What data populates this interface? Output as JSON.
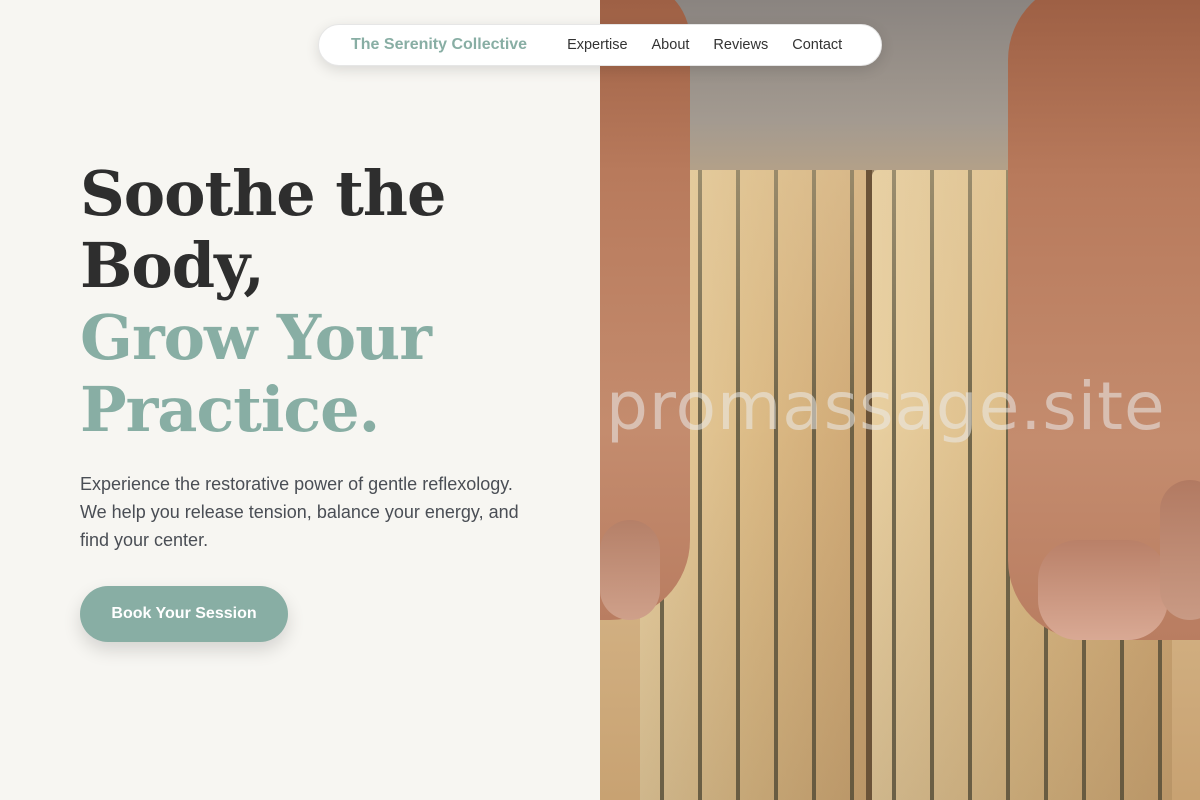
{
  "nav": {
    "brand": "The Serenity Collective",
    "links": [
      "Expertise",
      "About",
      "Reviews",
      "Contact"
    ]
  },
  "hero": {
    "headline_line1": "Soothe the",
    "headline_line2": "Body,",
    "headline_line3": "Grow Your",
    "headline_line4": "Practice.",
    "lead": "Experience the restorative power of gentle reflexology. We help you release tension, balance your energy, and find your center.",
    "cta_label": "Book Your Session"
  },
  "image": {
    "watermark": "promassage.site",
    "alt": "feet on a nail board"
  },
  "colors": {
    "accent": "#88aea4",
    "background": "#f7f6f2",
    "text_dark": "#2e2e2e"
  }
}
